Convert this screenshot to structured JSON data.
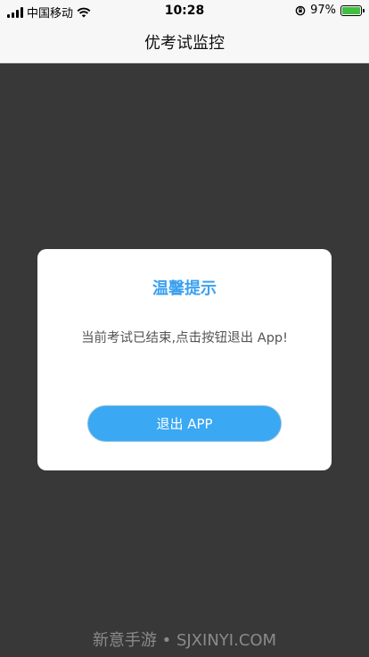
{
  "status_bar": {
    "carrier": "中国移动",
    "time": "10:28",
    "battery_percent": "97%",
    "icons": [
      "signal-icon",
      "wifi-icon",
      "orientation-lock-icon",
      "battery-charging-icon"
    ]
  },
  "nav": {
    "title": "优考试监控"
  },
  "dialog": {
    "title": "温馨提示",
    "message": "当前考试已结束,点击按钮退出 App!",
    "button_label": "退出 APP"
  },
  "watermark": "新意手游 • SJXINYI.COM",
  "colors": {
    "accent": "#3aa8f3",
    "overlay": "#383838",
    "title_blue": "#3aa0f0"
  }
}
